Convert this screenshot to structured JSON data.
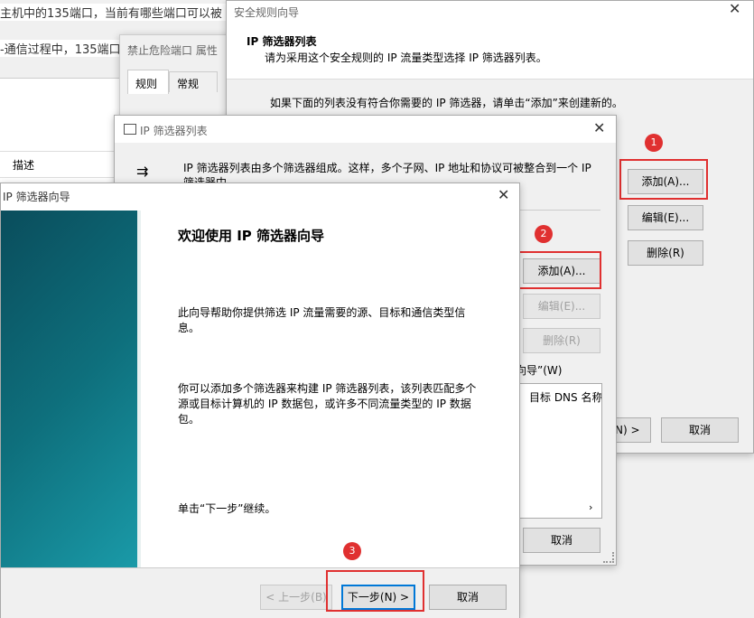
{
  "background_article": {
    "line1": "主机中的135端口，当前有哪些端口可以被",
    "line2": "-通信过程中，135端口",
    "column_desc": "描述"
  },
  "rule_props": {
    "title": "禁止危险端口 属性",
    "tabs": [
      "规则",
      "常规"
    ]
  },
  "security_wizard": {
    "title": "安全规则向导",
    "heading": "IP 筛选器列表",
    "subheading": "请为采用这个安全规则的 IP 流量类型选择 IP 筛选器列表。",
    "info": "如果下面的列表没有符合你需要的 IP 筛选器，请单击“添加”来创建新的。",
    "add_label": "添加(A)...",
    "edit_label": "编辑(E)...",
    "delete_label": "删除(R)",
    "next_partial": "N) >",
    "cancel_label": "取消",
    "badge": "1"
  },
  "filter_list": {
    "title": "IP 筛选器列表",
    "desc_line1": "IP 筛选器列表由多个筛选器组成。这样，多个子网、IP 地址和协议可被整合到一个 IP",
    "desc_line2": "筛选器中",
    "add_label": "添加(A)...",
    "edit_label": "编辑(E)...",
    "delete_label": "删除(R)",
    "wizard_check_partial": "向导”(W)",
    "column_dns": "目标 DNS 名称",
    "cancel_label": "取消",
    "badge": "2"
  },
  "filter_wizard": {
    "title": "IP 筛选器向导",
    "heading": "欢迎使用 IP 筛选器向导",
    "para1": "此向导帮助你提供筛选 IP 流量需要的源、目标和通信类型信息。",
    "para2": "你可以添加多个筛选器来构建 IP 筛选器列表，该列表匹配多个源或目标计算机的 IP 数据包，或许多不同流量类型的 IP 数据包。",
    "para3": "单击“下一步”继续。",
    "back_label": "< 上一步(B)",
    "next_label": "下一步(N) >",
    "cancel_label": "取消",
    "badge": "3"
  },
  "colors": {
    "highlight": "#e03030",
    "teal_dark": "#0a4d5c",
    "teal_light": "#1a9aa8"
  }
}
